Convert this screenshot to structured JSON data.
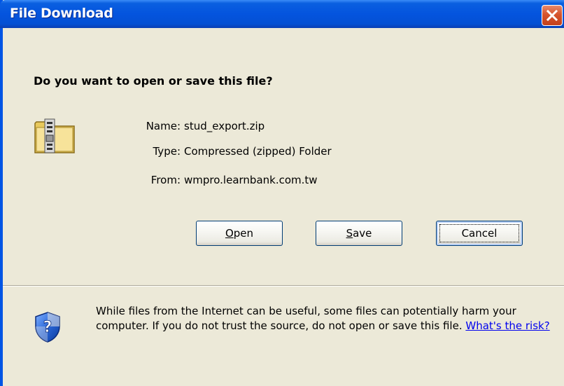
{
  "window": {
    "title": "File Download"
  },
  "dialog": {
    "question": "Do you want to open or save this file?",
    "file": {
      "name_label": "Name:",
      "name_value": "stud_export.zip",
      "type_label": "Type:",
      "type_value": "Compressed (zipped) Folder",
      "from_label": "From:",
      "from_value": "wmpro.learnbank.com.tw",
      "icon": "zip-folder-icon"
    },
    "buttons": {
      "open_label_u": "O",
      "open_label_rest": "pen",
      "save_label_u": "S",
      "save_label_rest": "ave",
      "cancel_label": "Cancel"
    },
    "warning": {
      "icon": "security-shield-icon",
      "text": "While files from the Internet can be useful, some files can potentially harm your computer. If you do not trust the source, do not open or save this file.",
      "link_text": "What's the risk?"
    }
  },
  "colors": {
    "titlebar": "#0454de",
    "close_button": "#d6542e",
    "dialog_background": "#ece9d8",
    "link": "#0000ee"
  }
}
